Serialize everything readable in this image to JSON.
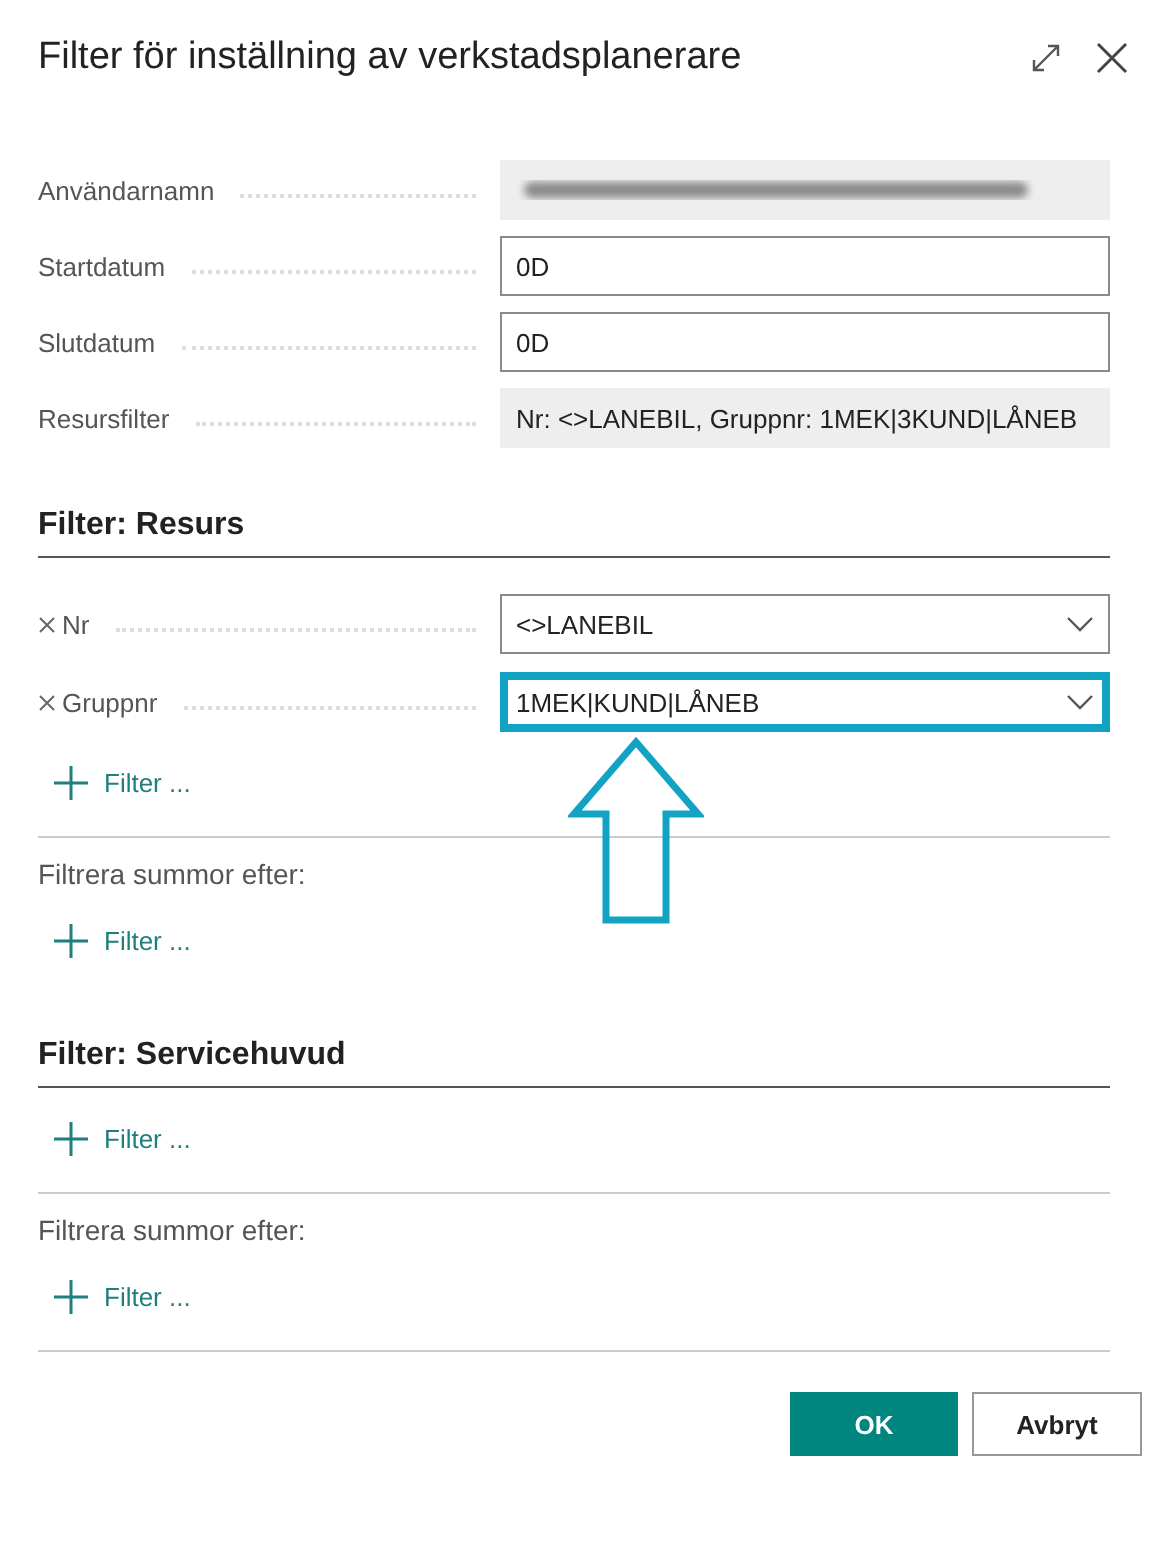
{
  "dialog": {
    "title": "Filter för inställning av verkstadsplanerare"
  },
  "fields": [
    {
      "label": "Användarnamn",
      "kind": "blurred"
    },
    {
      "label": "Startdatum",
      "kind": "input",
      "value": "0D"
    },
    {
      "label": "Slutdatum",
      "kind": "input",
      "value": "0D"
    },
    {
      "label": "Resursfilter",
      "kind": "readonly",
      "value": "Nr: <>LANEBIL, Gruppnr: 1MEK|3KUND|LÅNEB"
    }
  ],
  "sections": [
    {
      "title": "Filter: Resurs",
      "filters": [
        {
          "label": "Nr",
          "value": "<>LANEBIL",
          "highlighted": false
        },
        {
          "label": "Gruppnr",
          "value": "1MEK|KUND|LÅNEB",
          "highlighted": true
        }
      ],
      "add_filter": "Filter ...",
      "totals_label": "Filtrera summor efter:",
      "totals_add_filter": "Filter ..."
    },
    {
      "title": "Filter: Servicehuvud",
      "add_filter": "Filter ...",
      "totals_label": "Filtrera summor efter:",
      "totals_add_filter": "Filter ..."
    }
  ],
  "buttons": [
    {
      "label": "OK",
      "kind": "primary"
    },
    {
      "label": "Avbryt",
      "kind": "secondary"
    }
  ]
}
